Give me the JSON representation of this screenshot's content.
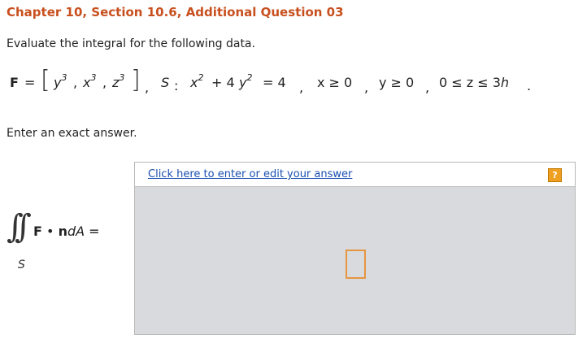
{
  "header": {
    "title": "Chapter 10, Section 10.6, Additional Question 03"
  },
  "prompt": "Evaluate the integral for the following data.",
  "math": {
    "F_symbol": "F",
    "equals": "=",
    "bracket_open": "[",
    "comp1": "y",
    "comp1_exp": "3",
    "comma1": ",",
    "comp2": "x",
    "comp2_exp": "3",
    "comma2": ",",
    "comp3": "z",
    "comp3_exp": "3",
    "bracket_close": "]",
    "sep1": ",",
    "S_label": "S",
    "colon": ":",
    "eq_x": "x",
    "eq_x_exp": "2",
    "eq_plus": "+ 4",
    "eq_y": "y",
    "eq_y_exp": "2",
    "eq_rhs": "= 4",
    "sep2": ",",
    "cond_x": "x ≥ 0",
    "sep3": ",",
    "cond_y": "y ≥ 0",
    "sep4": ",",
    "cond_z_pre": "0 ≤ z ≤ 3",
    "cond_z_h": "h",
    "end_dot": "."
  },
  "enter_text": "Enter an exact answer.",
  "integral": {
    "sub": "S",
    "expr_F": "F",
    "expr_dot": "•",
    "expr_n": "n",
    "expr_d": "d",
    "expr_A": "A",
    "expr_eq": "="
  },
  "answer": {
    "edit_link": "Click here to enter or edit your answer",
    "help_label": "?"
  },
  "colors": {
    "title": "#c8501e",
    "link": "#1a4fb0",
    "help_bg": "#f0a020",
    "answer_bg": "#d8dadd",
    "placeholder_border": "#e69540"
  }
}
